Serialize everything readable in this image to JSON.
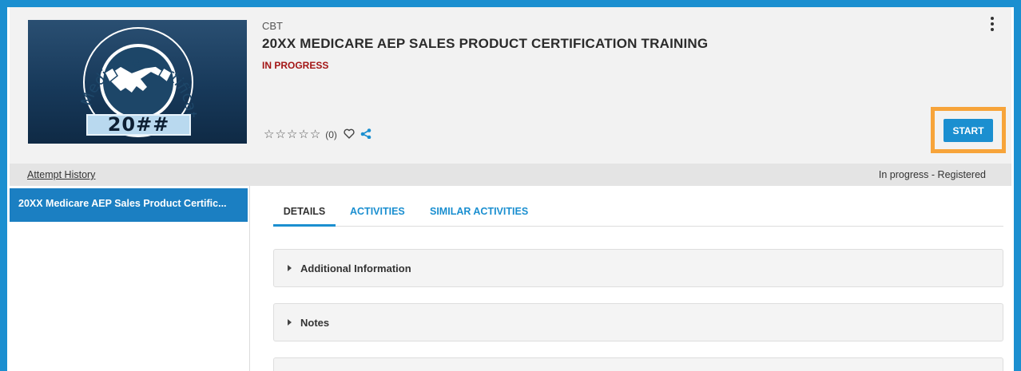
{
  "course": {
    "type": "CBT",
    "title": "20XX MEDICARE AEP SALES PRODUCT CERTIFICATION TRAINING",
    "status": "IN PROGRESS",
    "thumbnail": {
      "arc_text": "AEP Medicare Certification",
      "year": "20##"
    },
    "rating": {
      "stars": [
        "☆",
        "☆",
        "☆",
        "☆",
        "☆"
      ],
      "count": "(0)"
    },
    "start_label": "START"
  },
  "attempt_bar": {
    "history_label": "Attempt History",
    "status": "In progress - Registered"
  },
  "sidebar": {
    "items": [
      {
        "label": "20XX Medicare AEP Sales Product Certific..."
      }
    ]
  },
  "tabs": [
    {
      "label": "DETAILS"
    },
    {
      "label": "ACTIVITIES"
    },
    {
      "label": "SIMILAR ACTIVITIES"
    }
  ],
  "panels": [
    {
      "label": "Additional Information"
    },
    {
      "label": "Notes"
    }
  ],
  "icons": {
    "more": "kebab-menu-icon",
    "favorite": "heart-icon",
    "share": "share-icon",
    "handshake": "handshake-icon"
  },
  "colors": {
    "accent": "#1b8fd0",
    "status": "#a31515",
    "highlight": "#f7a43a"
  }
}
